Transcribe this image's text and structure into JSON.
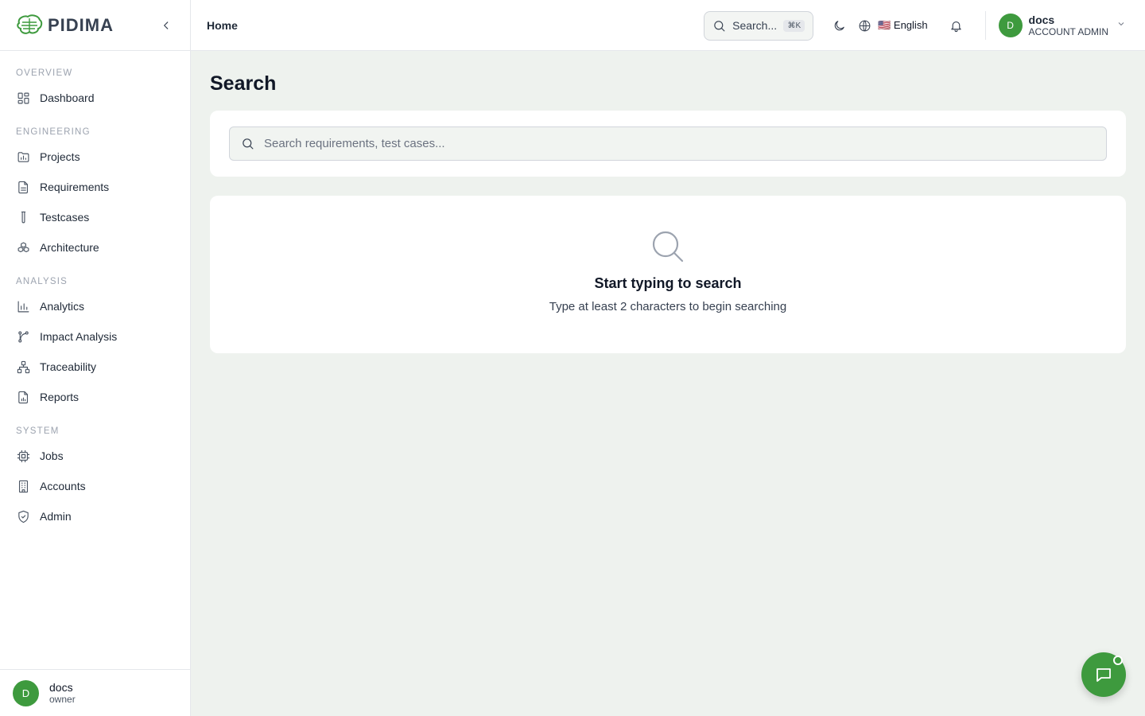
{
  "brand": {
    "name": "PIDIMA"
  },
  "sidebar": {
    "sections": [
      {
        "title": "OVERVIEW",
        "items": [
          {
            "label": "Dashboard",
            "icon": "dashboard-icon"
          }
        ]
      },
      {
        "title": "ENGINEERING",
        "items": [
          {
            "label": "Projects",
            "icon": "folder-chart-icon"
          },
          {
            "label": "Requirements",
            "icon": "document-icon"
          },
          {
            "label": "Testcases",
            "icon": "test-tube-icon"
          },
          {
            "label": "Architecture",
            "icon": "boxes-icon"
          }
        ]
      },
      {
        "title": "ANALYSIS",
        "items": [
          {
            "label": "Analytics",
            "icon": "bar-chart-icon"
          },
          {
            "label": "Impact Analysis",
            "icon": "git-branch-icon"
          },
          {
            "label": "Traceability",
            "icon": "network-icon"
          },
          {
            "label": "Reports",
            "icon": "report-icon"
          }
        ]
      },
      {
        "title": "SYSTEM",
        "items": [
          {
            "label": "Jobs",
            "icon": "cpu-icon"
          },
          {
            "label": "Accounts",
            "icon": "building-icon"
          },
          {
            "label": "Admin",
            "icon": "shield-check-icon"
          }
        ]
      }
    ],
    "footer": {
      "avatar_initial": "D",
      "name": "docs",
      "role": "owner"
    }
  },
  "header": {
    "breadcrumb": "Home",
    "search_label": "Search...",
    "search_shortcut": "⌘K",
    "language": "🇺🇸 English",
    "user": {
      "avatar_initial": "D",
      "name": "docs",
      "role": "ACCOUNT ADMIN"
    }
  },
  "main": {
    "title": "Search",
    "search_placeholder": "Search requirements, test cases...",
    "empty_title": "Start typing to search",
    "empty_subtitle": "Type at least 2 characters to begin searching"
  },
  "colors": {
    "accent": "#3e9a3e",
    "background": "#eef2ee"
  }
}
